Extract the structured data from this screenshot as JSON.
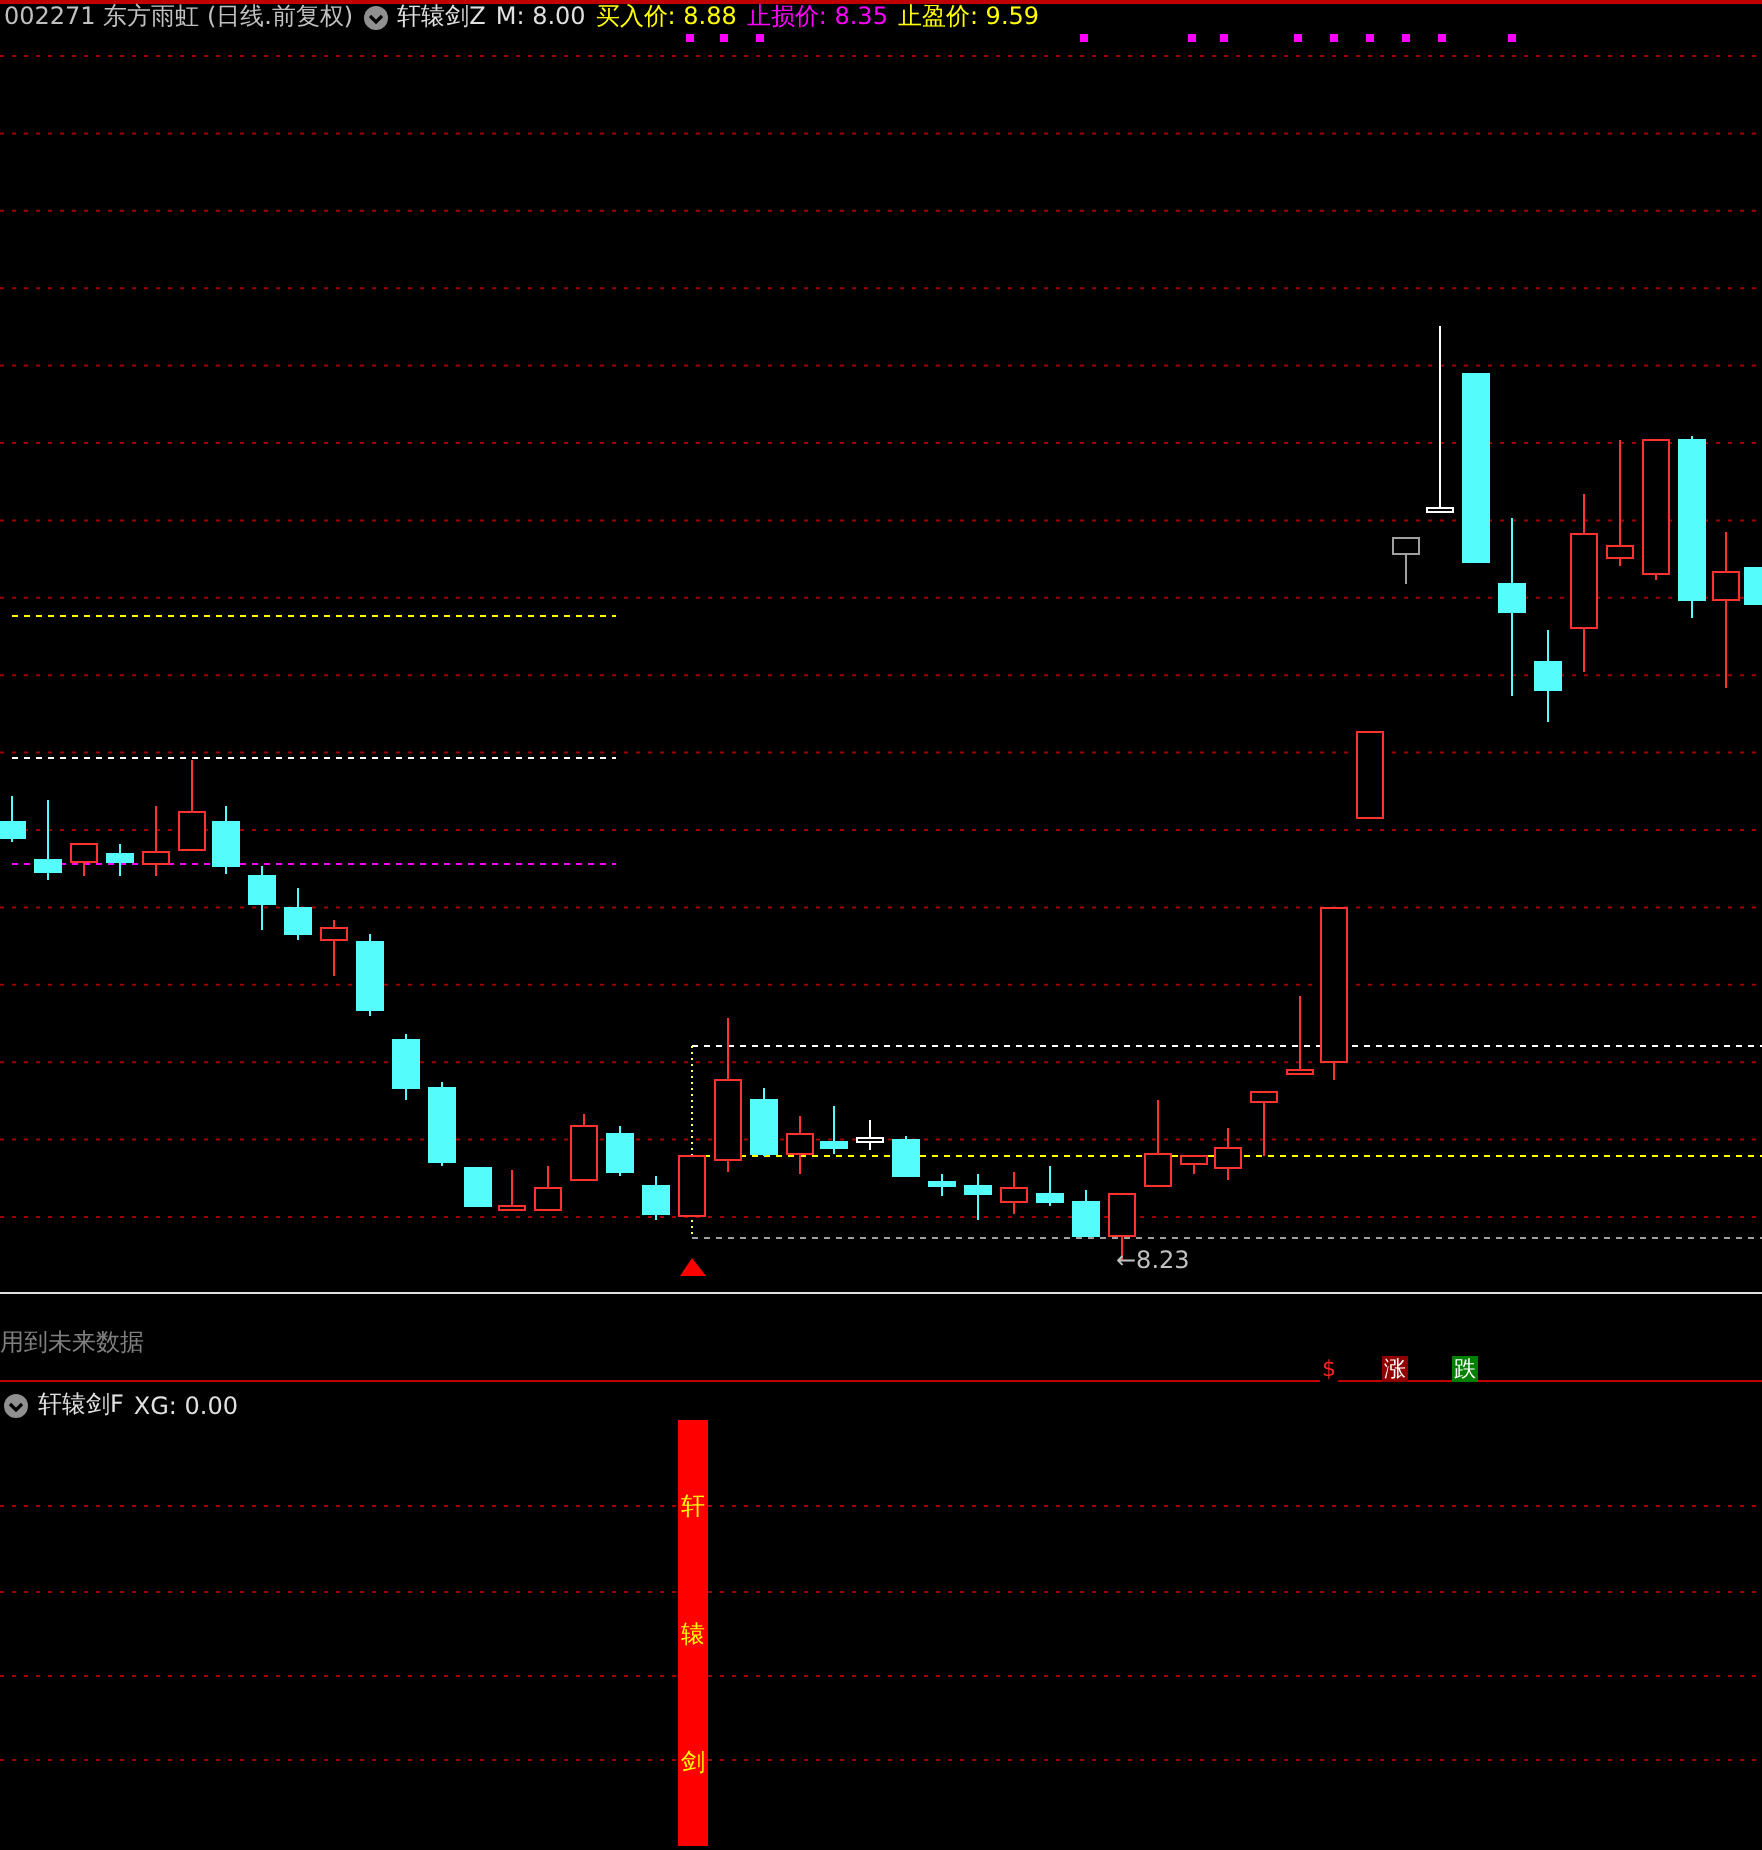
{
  "header": {
    "code": "002271",
    "name": "东方雨虹",
    "period": "(日线.前复权)",
    "indicator": "轩辕剑Z",
    "m": "M: 8.00",
    "prices": [
      {
        "kind": "buy",
        "text": "买入价: 8.88"
      },
      {
        "kind": "stop",
        "text": "止损价: 8.35"
      },
      {
        "kind": "target",
        "text": "止盈价: 9.59"
      }
    ]
  },
  "low_label": "←8.23",
  "warning": "用到未来数据",
  "badges": [
    {
      "kind": "plain",
      "text": "$"
    },
    {
      "kind": "up",
      "text": "涨"
    },
    {
      "kind": "down",
      "text": "跌"
    }
  ],
  "sub_panel": {
    "indicator": "轩辕剑F",
    "value": "XG: 0.00",
    "bar_text": "轩辕剑"
  }
}
